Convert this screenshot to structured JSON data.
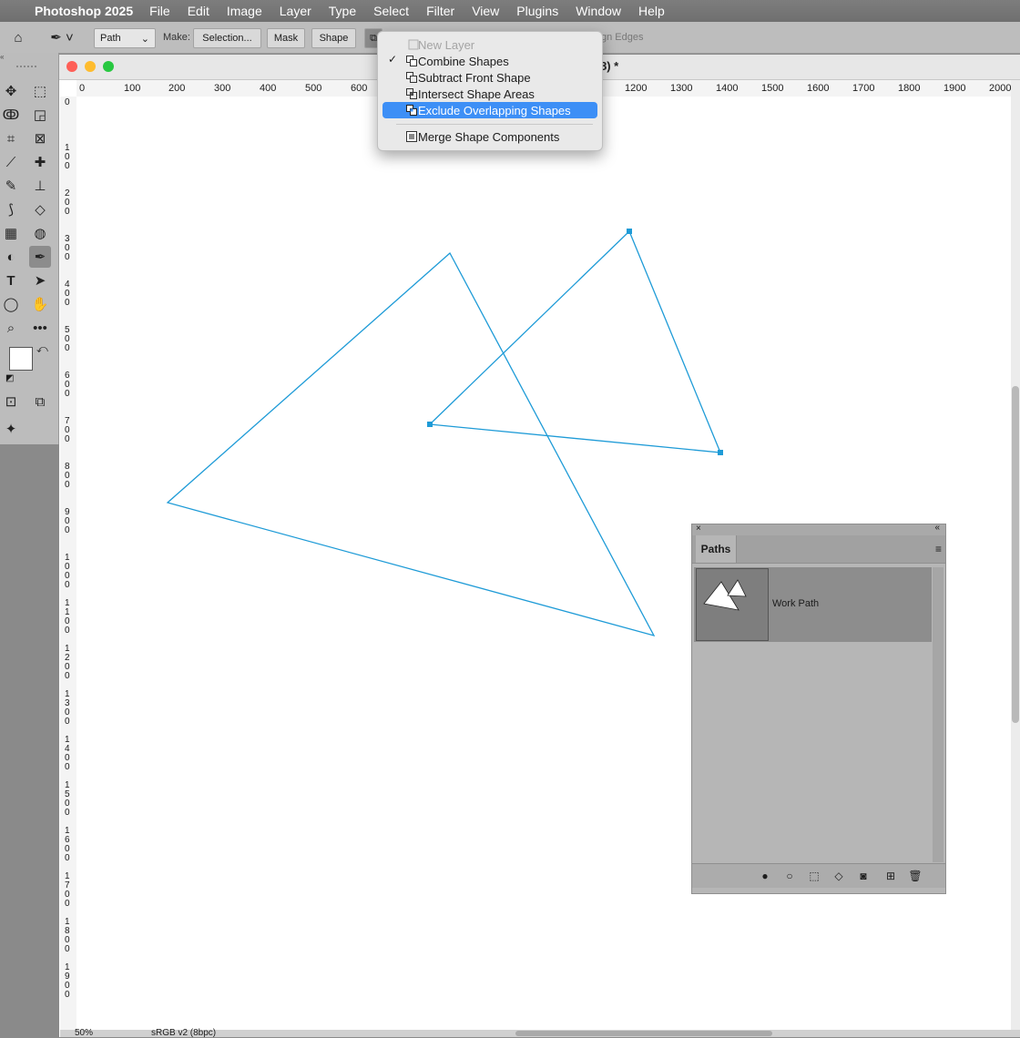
{
  "menubar": {
    "apple_icon": "apple-icon",
    "app_name": "Photoshop 2025",
    "items": [
      "File",
      "Edit",
      "Image",
      "Layer",
      "Type",
      "Select",
      "Filter",
      "View",
      "Plugins",
      "Window",
      "Help"
    ]
  },
  "options_bar": {
    "mode_value": "Path",
    "make_label": "Make:",
    "selection_button": "Selection...",
    "mask_button": "Mask",
    "shape_button": "Shape",
    "align_edges_label": "gn Edges"
  },
  "path_operations_menu": {
    "items": [
      {
        "label": "New Layer",
        "disabled": true,
        "checked": false,
        "highlighted": false
      },
      {
        "label": "Combine Shapes",
        "disabled": false,
        "checked": true,
        "highlighted": false
      },
      {
        "label": "Subtract Front Shape",
        "disabled": false,
        "checked": false,
        "highlighted": false
      },
      {
        "label": "Intersect Shape Areas",
        "disabled": false,
        "checked": false,
        "highlighted": false
      },
      {
        "label": "Exclude Overlapping Shapes",
        "disabled": false,
        "checked": false,
        "highlighted": true
      },
      {
        "label": "Merge Shape Components",
        "disabled": false,
        "checked": false,
        "highlighted": false
      }
    ]
  },
  "document": {
    "title_suffix": "8) *",
    "h_ruler": [
      "0",
      "100",
      "200",
      "300",
      "400",
      "500",
      "600",
      "1200",
      "1300",
      "1400",
      "1500",
      "1600",
      "1700",
      "1800",
      "1900",
      "2000"
    ],
    "v_ruler": [
      "0",
      "1\n0\n0",
      "2\n0\n0",
      "3\n0\n0",
      "4\n0\n0",
      "5\n0\n0",
      "6\n0\n0",
      "7\n0\n0",
      "8\n0\n0",
      "9\n0\n0",
      "1\n0\n0\n0",
      "1\n1\n0\n0",
      "1\n2\n0\n0",
      "1\n3\n0\n0",
      "1\n4\n0\n0",
      "1\n5\n0\n0",
      "1\n6\n0\n0",
      "1\n7\n0\n0",
      "1\n8\n0\n0",
      "1\n9\n0\n0"
    ],
    "path_color": "#1e9bd7",
    "status_zoom": "50%",
    "status_profile": "sRGB v2 (8bpc)"
  },
  "paths_panel": {
    "tab_label": "Paths",
    "rows": [
      {
        "name": "Work Path"
      }
    ],
    "footer_icons": [
      "fill-path-icon",
      "stroke-path-icon",
      "load-selection-icon",
      "make-work-path-icon",
      "add-mask-icon",
      "new-path-icon",
      "delete-path-icon"
    ]
  },
  "colors": {
    "highlight": "#3d8ff6",
    "menubar": "#747474"
  }
}
